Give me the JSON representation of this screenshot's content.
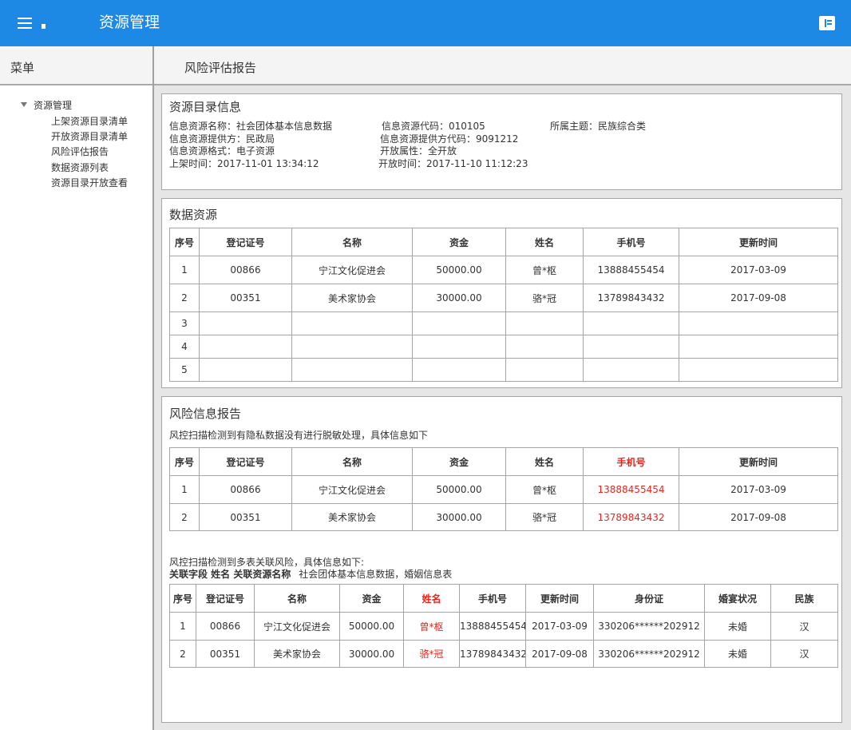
{
  "header": {
    "title": "资源管理"
  },
  "sidebar": {
    "heading": "菜单",
    "root": "资源管理",
    "items": [
      "上架资源目录清单",
      "开放资源目录清单",
      "风险评估报告",
      "数据资源列表",
      "资源目录开放查看"
    ]
  },
  "main": {
    "title": "风险评估报告"
  },
  "catalog": {
    "title": "资源目录信息",
    "name": "信息资源名称：社会团体基本信息数据",
    "code": "信息资源代码：010105",
    "theme": "所属主题：民族综合类",
    "provider": "信息资源提供方：民政局",
    "provider_code": "信息资源提供方代码：9091212",
    "format": "信息资源格式：电子资源",
    "open_attr": "开放属性：全开放",
    "publish_time": "上架时间：2017-11-01 13:34:12",
    "open_time": "开放时间：2017-11-10 11:12:23"
  },
  "data_resource": {
    "title": "数据资源",
    "headers": [
      "序号",
      "登记证号",
      "名称",
      "资金",
      "姓名",
      "手机号",
      "更新时间"
    ],
    "rows": [
      [
        "1",
        "00866",
        "宁江文化促进会",
        "50000.00",
        "曾*枢",
        "13888455454",
        "2017-03-09"
      ],
      [
        "2",
        "00351",
        "美术家协会",
        "30000.00",
        "骆*冠",
        "13789843432",
        "2017-09-08"
      ],
      [
        "3",
        "",
        "",
        "",
        "",
        "",
        ""
      ],
      [
        "4",
        "",
        "",
        "",
        "",
        "",
        ""
      ],
      [
        "5",
        "",
        "",
        "",
        "",
        "",
        ""
      ]
    ]
  },
  "risk": {
    "title": "风险信息报告",
    "desc1": "风控扫描检测到有隐私数据没有进行脱敏处理，具体信息如下",
    "table1": {
      "headers": [
        "序号",
        "登记证号",
        "名称",
        "资金",
        "姓名",
        "手机号",
        "更新时间"
      ],
      "rows": [
        [
          "1",
          "00866",
          "宁江文化促进会",
          "50000.00",
          "曾*枢",
          "13888455454",
          "2017-03-09"
        ],
        [
          "2",
          "00351",
          "美术家协会",
          "30000.00",
          "骆*冠",
          "13789843432",
          "2017-09-08"
        ]
      ]
    },
    "desc2": "风控扫描检测到多表关联风险，具体信息如下:",
    "assoc_label": "关联字段 姓名 关联资源名称",
    "assoc_value": "社会团体基本信息数据，婚姻信息表",
    "table2": {
      "headers": [
        "序号",
        "登记证号",
        "名称",
        "资金",
        "姓名",
        "手机号",
        "更新时间",
        "身份证",
        "婚宴状况",
        "民族"
      ],
      "rows": [
        [
          "1",
          "00866",
          "宁江文化促进会",
          "50000.00",
          "曾*枢",
          "13888455454",
          "2017-03-09",
          "330206******202912",
          "未婚",
          "汉"
        ],
        [
          "2",
          "00351",
          "美术家协会",
          "30000.00",
          "骆*冠",
          "13789843432",
          "2017-09-08",
          "330206******202912",
          "未婚",
          "汉"
        ]
      ]
    }
  },
  "colors": {
    "topbar": "#1e88e5",
    "highlight": "#e8261c"
  }
}
